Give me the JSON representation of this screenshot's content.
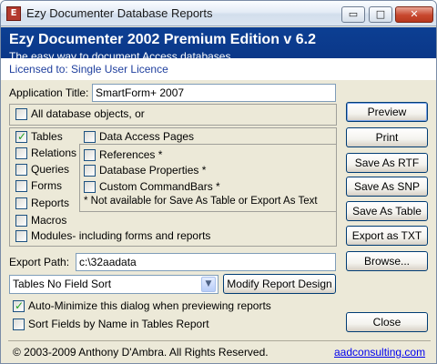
{
  "window": {
    "title": "Ezy Documenter Database Reports",
    "icon_glyph": "E",
    "minimize_glyph": "▭",
    "maximize_glyph": "□",
    "close_glyph": "✕"
  },
  "header": {
    "title": "Ezy Documenter 2002 Premium Edition v 6.2",
    "subtitle": "The easy way to document Access databases",
    "licence": "Licensed to: Single User Licence"
  },
  "app_title": {
    "label": "Application Title:",
    "value": "SmartForm+ 2007"
  },
  "all_objects": {
    "label": "All database objects, or",
    "checked": false
  },
  "objects": [
    {
      "label": "Tables",
      "checked": true
    },
    {
      "label": "Relations",
      "checked": false
    },
    {
      "label": "Queries",
      "checked": false
    },
    {
      "label": "Forms",
      "checked": false
    },
    {
      "label": "Reports",
      "checked": false
    },
    {
      "label": "Macros",
      "checked": false
    },
    {
      "label": "Modules- including forms and reports",
      "checked": false
    }
  ],
  "data_access_pages": {
    "label": "Data Access Pages",
    "checked": false
  },
  "extras": [
    {
      "label": "References *",
      "checked": false
    },
    {
      "label": "Database Properties *",
      "checked": false
    },
    {
      "label": "Custom CommandBars *",
      "checked": false
    }
  ],
  "extras_note": "* Not available for Save As Table or Export As Text",
  "buttons": {
    "preview": "Preview",
    "print": "Print",
    "save_rtf": "Save As RTF",
    "save_snp": "Save As SNP",
    "save_table": "Save As Table",
    "export_txt": "Export as TXT",
    "browse": "Browse...",
    "close": "Close",
    "modify": "Modify Report Design"
  },
  "export_path": {
    "label": "Export Path:",
    "value": "c:\\32aadata"
  },
  "sort_select": {
    "value": "Tables No Field Sort",
    "arrow": "▼"
  },
  "auto_minimize": {
    "label": "Auto-Minimize this dialog when previewing reports",
    "checked": true
  },
  "sort_fields": {
    "label": "Sort Fields by Name in Tables Report",
    "checked": false
  },
  "footer": {
    "copyright": "© 2003-2009 Anthony D'Ambra.  All Rights Reserved.",
    "link": "aadconsulting.com"
  },
  "colors": {
    "header_blue": "#0c3f93",
    "licence_blue": "#1f3f9e",
    "check_green": "#21a121"
  }
}
